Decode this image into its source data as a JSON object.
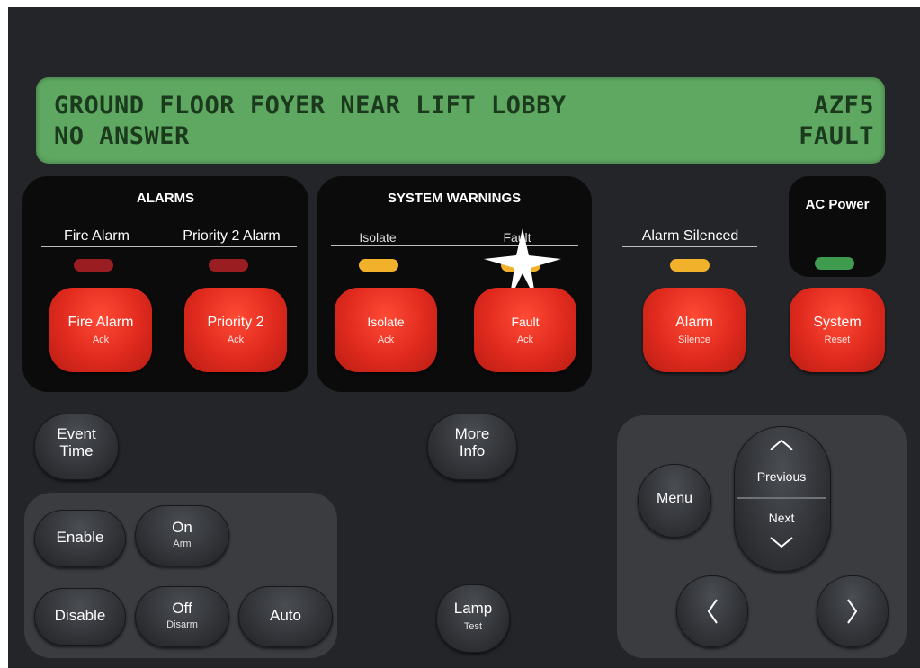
{
  "display": {
    "line1_location": "GROUND FLOOR FOYER NEAR LIFT LOBBY",
    "line1_zone": "AZF5",
    "line2_status": "NO ANSWER",
    "line2_type": "FAULT"
  },
  "alarms": {
    "title": "ALARMS",
    "fire_label": "Fire Alarm",
    "priority2_label": "Priority 2 Alarm",
    "fire_button": {
      "main": "Fire Alarm",
      "sub": "Ack"
    },
    "priority2_button": {
      "main": "Priority 2",
      "sub": "Ack"
    }
  },
  "warnings": {
    "title": "SYSTEM WARNINGS",
    "isolate_label": "Isolate",
    "fault_label": "Fault",
    "isolate_button": {
      "main": "Isolate",
      "sub": "Ack"
    },
    "fault_button": {
      "main": "Fault",
      "sub": "Ack"
    }
  },
  "silence": {
    "label": "Alarm Silenced",
    "button": {
      "main": "Alarm",
      "sub": "Silence"
    }
  },
  "power": {
    "title": "AC Power",
    "button": {
      "main": "System",
      "sub": "Reset"
    }
  },
  "controls": {
    "event_time": "Event Time",
    "more_info": "More Info",
    "enable": "Enable",
    "disable": "Disable",
    "on": "On",
    "arm": "Arm",
    "off": "Off",
    "disarm": "Disarm",
    "auto": "Auto",
    "lamp": "Lamp",
    "test": "Test"
  },
  "nav": {
    "menu": "Menu",
    "previous": "Previous",
    "next": "Next"
  },
  "colors": {
    "lcd": "#5fa862",
    "led_red": "#9a1d22",
    "led_amber": "#f2b12a",
    "led_green": "#3f9b4e",
    "button_red": "#e02a1e"
  }
}
